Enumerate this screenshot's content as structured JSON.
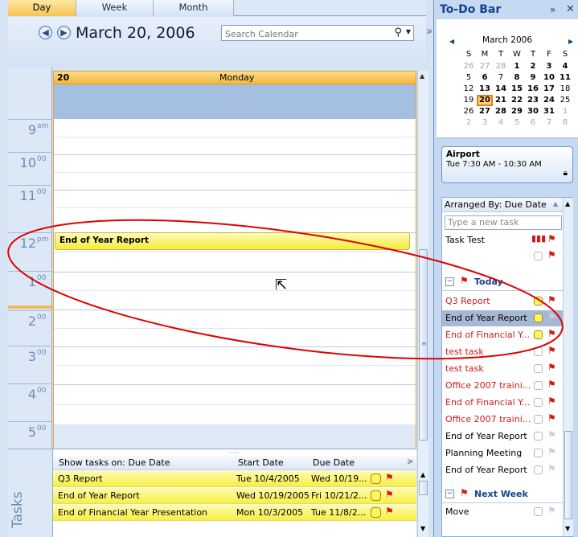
{
  "view_tabs": [
    "Day",
    "Week",
    "Month"
  ],
  "date_title": "March 20, 2006",
  "search": {
    "placeholder": "Search Calendar"
  },
  "day_header": {
    "num": "20",
    "weekday": "Monday"
  },
  "times": [
    {
      "h": "9",
      "m": "am"
    },
    {
      "h": "10",
      "m": "00"
    },
    {
      "h": "11",
      "m": "00"
    },
    {
      "h": "12",
      "m": "pm"
    },
    {
      "h": "1",
      "m": "00"
    },
    {
      "h": "2",
      "m": "00"
    },
    {
      "h": "3",
      "m": "00"
    },
    {
      "h": "4",
      "m": "00"
    },
    {
      "h": "5",
      "m": "00"
    }
  ],
  "appointment": {
    "title": "End of Year Report"
  },
  "tasks_strip": {
    "side_label": "Tasks",
    "header": {
      "show": "Show tasks on: Due Date",
      "start": "Start Date",
      "due": "Due Date"
    },
    "rows": [
      {
        "subject": "Q3 Report",
        "start": "Tue 10/4/2005",
        "due": "Wed 10/19..."
      },
      {
        "subject": "End of Year Report",
        "start": "Wed 10/19/2005",
        "due": "Fri 10/21/2..."
      },
      {
        "subject": "End of Financial Year Presentation",
        "start": "Mon 10/3/2005",
        "due": "Tue 11/8/2..."
      }
    ]
  },
  "todo_bar": {
    "title": "To-Do Bar",
    "minimize": "»",
    "close": "✕",
    "mini_calendar": {
      "month": "March 2006",
      "weekdays": [
        "S",
        "M",
        "T",
        "W",
        "T",
        "F",
        "S"
      ],
      "weeks": [
        [
          "26",
          "27",
          "28",
          "1",
          "2",
          "3",
          "4"
        ],
        [
          "5",
          "6",
          "7",
          "8",
          "9",
          "10",
          "11"
        ],
        [
          "12",
          "13",
          "14",
          "15",
          "16",
          "17",
          "18"
        ],
        [
          "19",
          "20",
          "21",
          "22",
          "23",
          "24",
          "25"
        ],
        [
          "26",
          "27",
          "28",
          "29",
          "30",
          "31",
          "1"
        ],
        [
          "2",
          "3",
          "4",
          "5",
          "6",
          "7",
          "8"
        ]
      ]
    },
    "upcoming": {
      "title": "Airport",
      "time": "Tue 7:30 AM - 10:30 AM"
    },
    "task_list": {
      "arranged_by": "Arranged By: Due Date",
      "new_task_placeholder": "Type a new task",
      "task_test": "Task Test",
      "today_label": "Today",
      "today_items": [
        "Q3 Report",
        "End of Year Report",
        "End of Financial Y...",
        "test task",
        "test task",
        "Office 2007 traini...",
        "End of Financial Y...",
        "Office 2007 traini...",
        "End of Year Report",
        "Planning Meeting",
        "End of Year Report"
      ],
      "next_week_label": "Next Week",
      "next_week_items": [
        "Move"
      ]
    }
  },
  "colors": {
    "accent_orange": "#f0a32f",
    "task_yellow": "#f5ec3b",
    "overdue_red": "#d21a1a",
    "annotation_red": "#e00000"
  }
}
